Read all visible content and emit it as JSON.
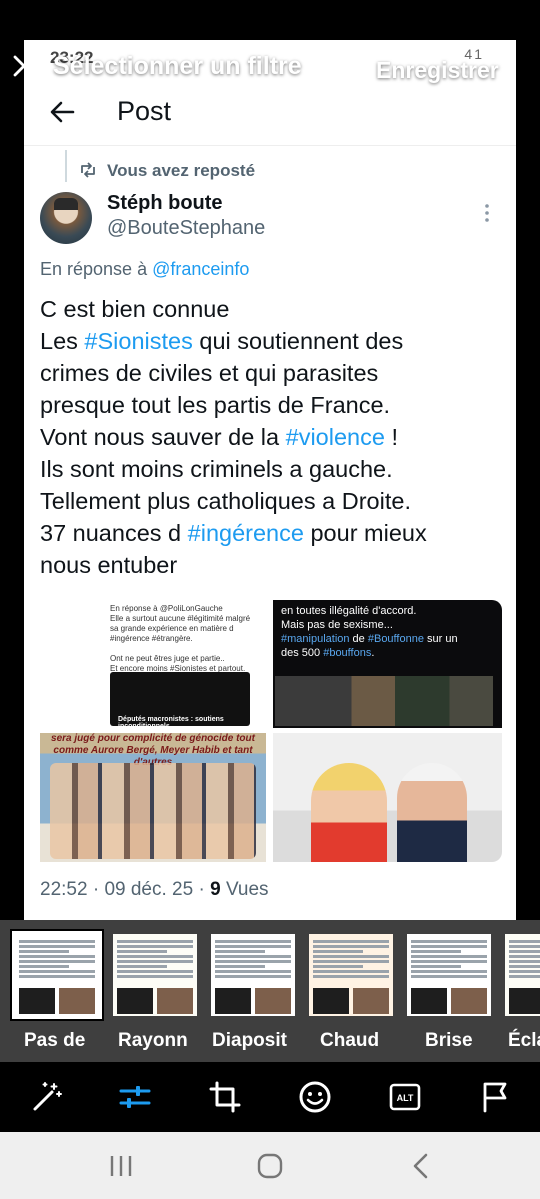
{
  "status_bar": {
    "time": "23:22",
    "icons": "✉ X ▶ •",
    "battery": "41"
  },
  "overlay": {
    "title": "Sélectionner un filtre",
    "save_label": "Enregistrer"
  },
  "post": {
    "header_title": "Post",
    "repost_text": "Vous avez reposté",
    "author_name": "Stéph boute",
    "author_handle": "@BouteStephane",
    "reply_prefix": "En réponse à ",
    "reply_mention": "@franceinfo",
    "lines": [
      {
        "text": "C est bien connue"
      },
      {
        "pre": "Les ",
        "tag": "#Sionistes",
        "post": " qui  soutiennent des"
      },
      {
        "text": "crimes de civiles et qui parasites"
      },
      {
        "text": "presque tout les partis de France."
      },
      {
        "pre": "Vont nous sauver de la ",
        "tag": "#violence",
        "post": " !"
      },
      {
        "text": "Ils sont moins criminels a gauche."
      },
      {
        "text": "Tellement plus catholiques a Droite."
      },
      {
        "pre": "37 nuances d ",
        "tag": "#ingérence",
        "post": " pour mieux"
      },
      {
        "text": "nous entuber"
      }
    ],
    "media": {
      "m1_text": "En réponse à @PoliLonGauche\nElle a surtout aucune #légitimité malgré sa grande expérience en matière d #ingérence #étrangère.\n\nOnt ne peut êtres juge et partie..\nEt encore moins #Sionistes et partout.",
      "m1_caption": "Députés macronistes : soutiens inconditionnels",
      "m2_pre": "en toutes illégalité d'accord.\nMais pas de sexisme...\n",
      "m2_tag1": "#manipulation",
      "m2_mid": " de ",
      "m2_tag2": "#Bouffonne",
      "m2_mid2": " sur un\ndes 500 ",
      "m2_tag3": "#bouffons",
      "m2_end": ".",
      "m3_caption": "sera jugé pour complicité de génocide tout comme Aurore Bergé, Meyer Habib et tant d'autres"
    },
    "time": "22:52",
    "date": "09 déc. 25",
    "views_count": "9",
    "views_label": "Vues"
  },
  "filters": [
    {
      "label": "Pas de",
      "style": "",
      "selected": true
    },
    {
      "label": "Rayonn",
      "style": "bright",
      "selected": false
    },
    {
      "label": "Diaposit",
      "style": "",
      "selected": false
    },
    {
      "label": "Chaud",
      "style": "warm",
      "selected": false
    },
    {
      "label": "Brise",
      "style": "",
      "selected": false
    },
    {
      "label": "Écla",
      "style": "bright",
      "selected": false
    }
  ],
  "toolbar_icons": [
    "magic-wand-icon",
    "sliders-icon",
    "crop-icon",
    "smiley-icon",
    "alt-text-icon",
    "flag-icon"
  ],
  "alt_label": "ALT",
  "colors": {
    "link": "#1d9bf0",
    "accent_tool": "#1d9bf0",
    "strip_bg": "#3f3f3f"
  }
}
